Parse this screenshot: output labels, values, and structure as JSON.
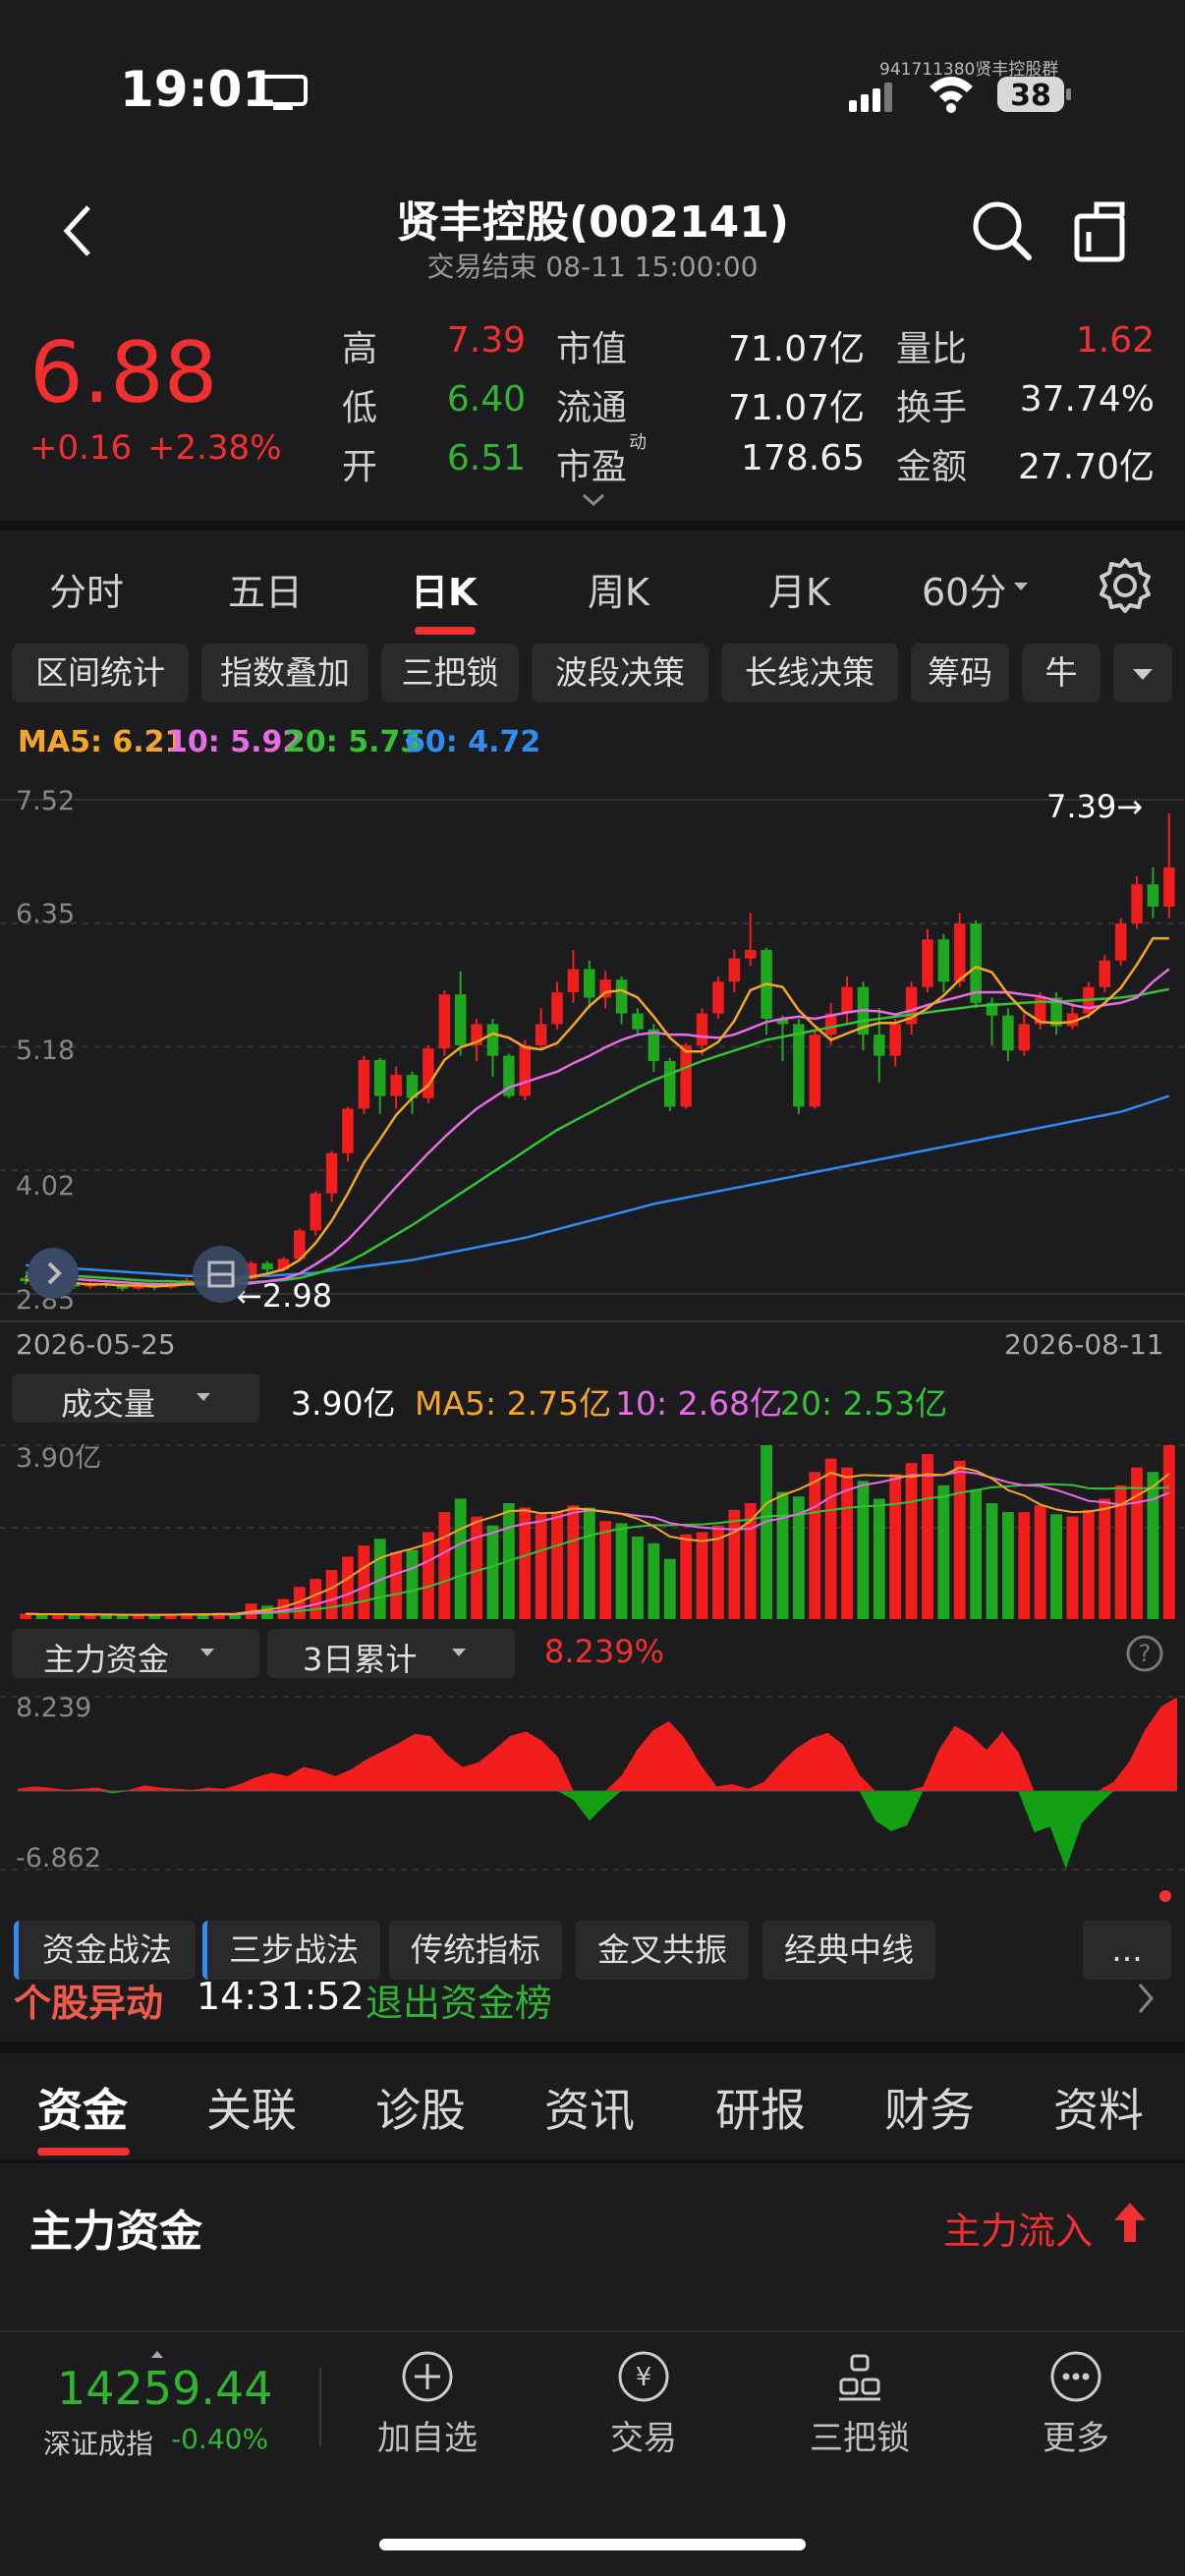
{
  "status_bar": {
    "time": "19:01",
    "watermark": "941711380贤丰控股群",
    "battery": "38"
  },
  "header": {
    "title": "贤丰控股(002141)",
    "subtitle": "交易结束 08-11 15:00:00"
  },
  "quote": {
    "price": "6.88",
    "change": "+0.16",
    "change_pct": "+2.38%",
    "high_label": "高",
    "high": "7.39",
    "low_label": "低",
    "low": "6.40",
    "open_label": "开",
    "open": "6.51",
    "mcap_label": "市值",
    "mcap": "71.07亿",
    "float_label": "流通",
    "float": "71.07亿",
    "pe_label": "市盈",
    "pe_sup": "动",
    "pe": "178.65",
    "vr_label": "量比",
    "vr": "1.62",
    "turnover_label": "换手",
    "turnover": "37.74%",
    "amount_label": "金额",
    "amount": "27.70亿"
  },
  "k_tabs": [
    "分时",
    "五日",
    "日K",
    "周K",
    "月K",
    "60分"
  ],
  "k_tab_active": "日K",
  "chips": [
    "区间统计",
    "指数叠加",
    "三把锁",
    "波段决策",
    "长线决策",
    "筹码",
    "牛"
  ],
  "ma_line": {
    "ma5": "MA5: 6.21",
    "ma10": "10: 5.92",
    "ma20": "20: 5.73",
    "ma60": "60: 4.72",
    "colors": {
      "ma5": "#f5a623",
      "ma10": "#e86be8",
      "ma20": "#35c335",
      "ma60": "#2f8cf0"
    }
  },
  "kchart": {
    "y_ticks": [
      "7.52",
      "6.35",
      "5.18",
      "4.02",
      "2.85"
    ],
    "max_label": "7.39→",
    "min_label": "←2.98",
    "date_start": "2026-05-25",
    "date_end": "2026-08-11"
  },
  "volume": {
    "selector": "成交量",
    "value": "3.90亿",
    "ma5": "MA5: 2.75亿",
    "ma10": "10: 2.68亿",
    "ma20": "20: 2.53亿",
    "y_top": "3.90亿"
  },
  "capital": {
    "selector": "主力资金",
    "period": "3日累计",
    "value": "8.239%",
    "y_top": "8.239",
    "y_bottom": "-6.862"
  },
  "sub_tabs": [
    "资金战法",
    "三步战法",
    "传统指标",
    "金叉共振",
    "经典中线",
    "..."
  ],
  "alert": {
    "title": "个股异动",
    "time": "14:31:52",
    "text": "退出资金榜"
  },
  "news_tabs": [
    "资金",
    "关联",
    "诊股",
    "资讯",
    "研报",
    "财务",
    "资料"
  ],
  "news_tab_active": "资金",
  "main_fund": {
    "title": "主力资金",
    "status": "主力流入"
  },
  "bottom": {
    "index_value": "14259.44",
    "index_name": "深证成指",
    "index_change": "-0.40%",
    "buttons": [
      "加自选",
      "交易",
      "三把锁",
      "更多"
    ]
  },
  "chart_data": [
    {
      "type": "candlestick",
      "title": "",
      "x_range": [
        "2026-05-25",
        "2026-08-11"
      ],
      "ylim": [
        2.85,
        7.52
      ],
      "candles": [
        [
          3.0,
          2.97,
          3.02,
          2.94
        ],
        [
          2.97,
          2.94,
          2.99,
          2.91
        ],
        [
          2.94,
          2.96,
          2.98,
          2.92
        ],
        [
          2.96,
          2.92,
          2.97,
          2.9
        ],
        [
          2.92,
          2.95,
          2.97,
          2.9
        ],
        [
          2.95,
          2.93,
          2.96,
          2.91
        ],
        [
          2.93,
          2.9,
          2.94,
          2.88
        ],
        [
          2.9,
          2.93,
          2.95,
          2.89
        ],
        [
          2.93,
          2.91,
          2.94,
          2.89
        ],
        [
          2.91,
          2.95,
          2.96,
          2.9
        ],
        [
          2.95,
          2.98,
          3.0,
          2.93
        ],
        [
          2.98,
          2.96,
          2.99,
          2.95
        ],
        [
          2.96,
          3.02,
          3.04,
          2.95
        ],
        [
          3.02,
          2.99,
          3.03,
          2.97
        ],
        [
          2.99,
          3.14,
          3.16,
          2.98
        ],
        [
          3.14,
          3.08,
          3.16,
          3.05
        ],
        [
          3.08,
          3.18,
          3.2,
          3.06
        ],
        [
          3.18,
          3.45,
          3.47,
          3.16
        ],
        [
          3.45,
          3.8,
          3.82,
          3.4
        ],
        [
          3.8,
          4.18,
          4.2,
          3.72
        ],
        [
          4.18,
          4.6,
          4.62,
          4.1
        ],
        [
          4.6,
          5.06,
          5.1,
          4.55
        ],
        [
          5.06,
          4.72,
          5.08,
          4.55
        ],
        [
          4.72,
          4.92,
          5.0,
          4.6
        ],
        [
          4.92,
          4.7,
          4.95,
          4.55
        ],
        [
          4.7,
          5.17,
          5.2,
          4.65
        ],
        [
          5.17,
          5.68,
          5.72,
          5.1
        ],
        [
          5.68,
          5.2,
          5.9,
          5.1
        ],
        [
          5.2,
          5.4,
          5.45,
          5.05
        ],
        [
          5.4,
          5.1,
          5.45,
          4.9
        ],
        [
          5.1,
          4.72,
          5.12,
          4.7
        ],
        [
          4.72,
          5.2,
          5.25,
          4.68
        ],
        [
          5.2,
          5.4,
          5.55,
          5.15
        ],
        [
          5.4,
          5.7,
          5.8,
          5.35
        ],
        [
          5.7,
          5.92,
          6.1,
          5.6
        ],
        [
          5.92,
          5.65,
          6.0,
          5.55
        ],
        [
          5.65,
          5.82,
          5.9,
          5.55
        ],
        [
          5.82,
          5.5,
          5.85,
          5.4
        ],
        [
          5.5,
          5.35,
          5.55,
          5.3
        ],
        [
          5.35,
          5.05,
          5.4,
          4.95
        ],
        [
          5.05,
          4.62,
          5.08,
          4.58
        ],
        [
          4.62,
          5.2,
          5.22,
          4.6
        ],
        [
          5.2,
          5.5,
          5.55,
          5.1
        ],
        [
          5.5,
          5.8,
          5.85,
          5.45
        ],
        [
          5.8,
          6.02,
          6.1,
          5.7
        ],
        [
          6.02,
          6.1,
          6.45,
          5.95
        ],
        [
          6.1,
          5.45,
          6.12,
          5.3
        ],
        [
          5.45,
          5.4,
          5.48,
          5.05
        ],
        [
          5.4,
          4.62,
          5.45,
          4.55
        ],
        [
          4.62,
          5.3,
          5.35,
          4.6
        ],
        [
          5.3,
          5.5,
          5.6,
          5.2
        ],
        [
          5.5,
          5.75,
          5.85,
          5.4
        ],
        [
          5.75,
          5.3,
          5.8,
          5.15
        ],
        [
          5.3,
          5.1,
          5.55,
          4.85
        ],
        [
          5.1,
          5.4,
          5.45,
          5.0
        ],
        [
          5.4,
          5.75,
          5.8,
          5.3
        ],
        [
          5.75,
          6.2,
          6.3,
          5.7
        ],
        [
          6.2,
          5.8,
          6.25,
          5.7
        ],
        [
          5.8,
          6.35,
          6.45,
          5.75
        ],
        [
          6.35,
          5.6,
          6.38,
          5.55
        ],
        [
          5.6,
          5.48,
          5.65,
          5.2
        ],
        [
          5.48,
          5.15,
          5.55,
          5.05
        ],
        [
          5.15,
          5.4,
          5.5,
          5.1
        ],
        [
          5.4,
          5.65,
          5.7,
          5.35
        ],
        [
          5.65,
          5.38,
          5.7,
          5.3
        ],
        [
          5.38,
          5.5,
          5.6,
          5.35
        ],
        [
          5.5,
          5.75,
          5.8,
          5.45
        ],
        [
          5.75,
          6.0,
          6.05,
          5.7
        ],
        [
          6.0,
          6.35,
          6.4,
          5.95
        ],
        [
          6.35,
          6.72,
          6.8,
          6.3
        ],
        [
          6.72,
          6.51,
          6.88,
          6.4
        ],
        [
          6.51,
          6.88,
          7.39,
          6.4
        ]
      ],
      "ma5": [
        2.98,
        2.97,
        2.96,
        2.95,
        2.94,
        2.94,
        2.93,
        2.93,
        2.92,
        2.93,
        2.94,
        2.95,
        2.97,
        2.98,
        3.01,
        3.04,
        3.08,
        3.17,
        3.33,
        3.54,
        3.8,
        4.09,
        4.31,
        4.54,
        4.7,
        4.82,
        5.06,
        5.18,
        5.23,
        5.31,
        5.27,
        5.18,
        5.16,
        5.22,
        5.39,
        5.57,
        5.7,
        5.72,
        5.65,
        5.47,
        5.27,
        5.14,
        5.14,
        5.23,
        5.43,
        5.72,
        5.78,
        5.75,
        5.53,
        5.38,
        5.25,
        5.31,
        5.37,
        5.41,
        5.41,
        5.46,
        5.55,
        5.67,
        5.82,
        5.94,
        5.89,
        5.68,
        5.52,
        5.42,
        5.41,
        5.42,
        5.48,
        5.6,
        5.74,
        5.96,
        6.21,
        6.21
      ],
      "ma10": [
        3.02,
        3.01,
        3.0,
        2.99,
        2.98,
        2.97,
        2.96,
        2.95,
        2.94,
        2.94,
        2.94,
        2.94,
        2.94,
        2.94,
        2.95,
        2.97,
        2.99,
        3.04,
        3.13,
        3.23,
        3.36,
        3.52,
        3.69,
        3.86,
        4.02,
        4.18,
        4.33,
        4.47,
        4.6,
        4.7,
        4.8,
        4.85,
        4.9,
        4.95,
        5.03,
        5.1,
        5.18,
        5.25,
        5.3,
        5.32,
        5.3,
        5.3,
        5.28,
        5.27,
        5.3,
        5.36,
        5.42,
        5.45,
        5.47,
        5.45,
        5.48,
        5.51,
        5.53,
        5.52,
        5.49,
        5.53,
        5.58,
        5.62,
        5.66,
        5.7,
        5.7,
        5.7,
        5.68,
        5.66,
        5.62,
        5.58,
        5.55,
        5.58,
        5.6,
        5.65,
        5.8,
        5.92
      ],
      "ma20": [
        3.05,
        3.04,
        3.03,
        3.02,
        3.01,
        3.0,
        2.99,
        2.98,
        2.97,
        2.97,
        2.96,
        2.96,
        2.96,
        2.96,
        2.96,
        2.97,
        2.98,
        3.0,
        3.04,
        3.09,
        3.15,
        3.23,
        3.32,
        3.41,
        3.5,
        3.6,
        3.7,
        3.8,
        3.9,
        4.0,
        4.1,
        4.2,
        4.3,
        4.4,
        4.48,
        4.56,
        4.64,
        4.72,
        4.8,
        4.87,
        4.93,
        4.99,
        5.05,
        5.1,
        5.15,
        5.2,
        5.25,
        5.28,
        5.31,
        5.34,
        5.37,
        5.4,
        5.43,
        5.45,
        5.47,
        5.49,
        5.51,
        5.53,
        5.55,
        5.57,
        5.58,
        5.59,
        5.6,
        5.61,
        5.61,
        5.62,
        5.63,
        5.64,
        5.65,
        5.67,
        5.7,
        5.73
      ],
      "ma60": [
        3.12,
        3.11,
        3.1,
        3.09,
        3.08,
        3.07,
        3.06,
        3.05,
        3.04,
        3.03,
        3.02,
        3.02,
        3.02,
        3.02,
        3.02,
        3.02,
        3.03,
        3.04,
        3.05,
        3.07,
        3.09,
        3.11,
        3.13,
        3.15,
        3.17,
        3.2,
        3.23,
        3.26,
        3.29,
        3.32,
        3.35,
        3.38,
        3.42,
        3.46,
        3.5,
        3.54,
        3.58,
        3.62,
        3.66,
        3.7,
        3.73,
        3.76,
        3.79,
        3.82,
        3.85,
        3.88,
        3.91,
        3.94,
        3.97,
        4.0,
        4.03,
        4.06,
        4.09,
        4.12,
        4.15,
        4.18,
        4.21,
        4.24,
        4.27,
        4.3,
        4.33,
        4.36,
        4.39,
        4.42,
        4.45,
        4.48,
        4.51,
        4.54,
        4.57,
        4.62,
        4.67,
        4.72
      ]
    },
    {
      "type": "bar",
      "title": "成交量",
      "unit": "亿",
      "ylim": [
        0,
        3.9
      ],
      "values": [
        0.12,
        0.1,
        0.11,
        0.1,
        0.09,
        0.1,
        0.08,
        0.1,
        0.09,
        0.11,
        0.13,
        0.1,
        0.14,
        0.12,
        0.35,
        0.3,
        0.45,
        0.72,
        0.9,
        1.1,
        1.4,
        1.65,
        1.8,
        1.5,
        1.55,
        1.95,
        2.4,
        2.7,
        2.3,
        2.1,
        2.6,
        2.5,
        2.35,
        2.4,
        2.55,
        2.5,
        2.2,
        2.15,
        1.85,
        1.7,
        1.35,
        1.9,
        1.95,
        2.1,
        2.45,
        2.6,
        3.9,
        2.85,
        2.75,
        3.3,
        3.6,
        3.4,
        3.1,
        2.7,
        3.25,
        3.5,
        3.7,
        3.0,
        3.55,
        2.9,
        2.6,
        2.4,
        2.4,
        2.55,
        2.35,
        2.3,
        2.45,
        2.7,
        3.0,
        3.4,
        3.3,
        3.9
      ],
      "up": [
        1,
        0,
        1,
        0,
        1,
        0,
        0,
        1,
        0,
        1,
        1,
        0,
        1,
        0,
        1,
        0,
        1,
        1,
        1,
        1,
        1,
        1,
        0,
        1,
        0,
        1,
        1,
        0,
        1,
        0,
        0,
        1,
        1,
        1,
        1,
        0,
        1,
        0,
        0,
        0,
        0,
        1,
        1,
        1,
        1,
        1,
        0,
        0,
        0,
        1,
        1,
        1,
        0,
        0,
        1,
        1,
        1,
        0,
        1,
        0,
        0,
        0,
        1,
        1,
        0,
        1,
        1,
        1,
        1,
        1,
        0,
        1
      ]
    },
    {
      "type": "area",
      "title": "主力资金 3日累计",
      "ylim": [
        -6.862,
        8.239
      ],
      "values": [
        0.2,
        0.4,
        0.3,
        0.1,
        0.2,
        0.3,
        -0.2,
        0.1,
        0.5,
        0.3,
        0.2,
        0.1,
        0.3,
        0.2,
        0.6,
        1.2,
        1.6,
        1.3,
        2.1,
        1.8,
        1.3,
        1.9,
        2.8,
        3.5,
        4.2,
        5.0,
        4.8,
        3.2,
        2.1,
        2.5,
        3.6,
        4.8,
        5.2,
        4.4,
        3.0,
        -0.8,
        -2.6,
        -1.2,
        1.3,
        3.6,
        5.3,
        6.1,
        4.6,
        2.3,
        0.4,
        0.6,
        0.2,
        0.8,
        2.4,
        3.7,
        4.6,
        5.1,
        4.0,
        1.4,
        -2.6,
        -3.5,
        -3.0,
        0.4,
        3.6,
        5.7,
        4.9,
        3.6,
        5.2,
        3.4,
        -3.6,
        -3.1,
        -6.8,
        -2.8,
        -1.3,
        0.8,
        2.6,
        5.4,
        7.4,
        8.2
      ]
    }
  ]
}
